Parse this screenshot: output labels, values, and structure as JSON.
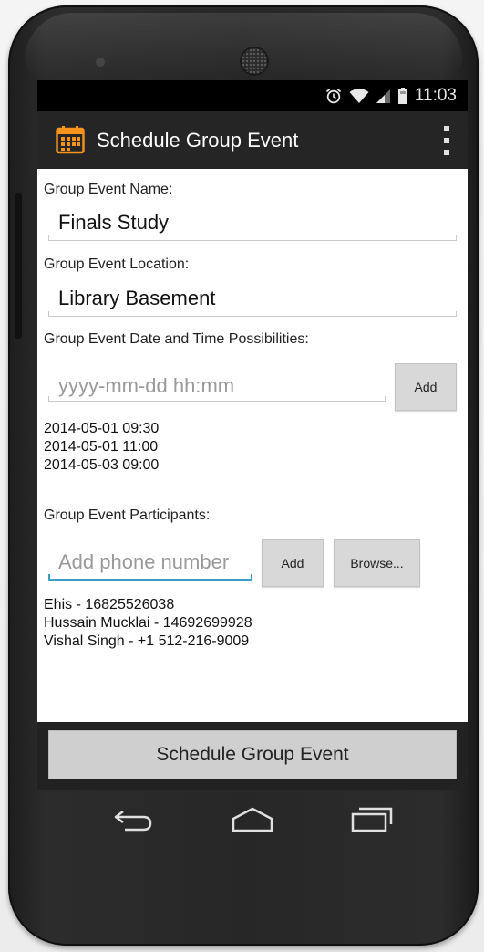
{
  "status_bar": {
    "time": "11:03",
    "icons": [
      "alarm-icon",
      "wifi-icon",
      "cell-signal-icon",
      "battery-icon"
    ]
  },
  "action_bar": {
    "app_icon": "calendar-icon",
    "title": "Schedule Group Event",
    "menu_icon": "overflow-menu-icon"
  },
  "form": {
    "event_name": {
      "label": "Group Event Name:",
      "value": "Finals Study"
    },
    "event_location": {
      "label": "Group Event Location:",
      "value": "Library Basement"
    },
    "date_time": {
      "label": "Group Event Date and Time Possibilities:",
      "placeholder": "yyyy-mm-dd hh:mm",
      "add_label": "Add",
      "entries": [
        "2014-05-01 09:30",
        "2014-05-01 11:00",
        "2014-05-03 09:00"
      ]
    },
    "participants": {
      "label": "Group Event Participants:",
      "placeholder": "Add phone number",
      "add_label": "Add",
      "browse_label": "Browse...",
      "entries": [
        "Ehis - 16825526038",
        "Hussain Mucklai - 14692699928",
        "Vishal Singh - +1 512-216-9009"
      ]
    }
  },
  "footer": {
    "schedule_label": "Schedule Group Event"
  },
  "navigation": {
    "icons": [
      "back-icon",
      "home-icon",
      "recent-apps-icon"
    ]
  },
  "colors": {
    "accent": "#3aa0c8",
    "app_icon": "#f7941d",
    "action_bar": "#252525"
  }
}
